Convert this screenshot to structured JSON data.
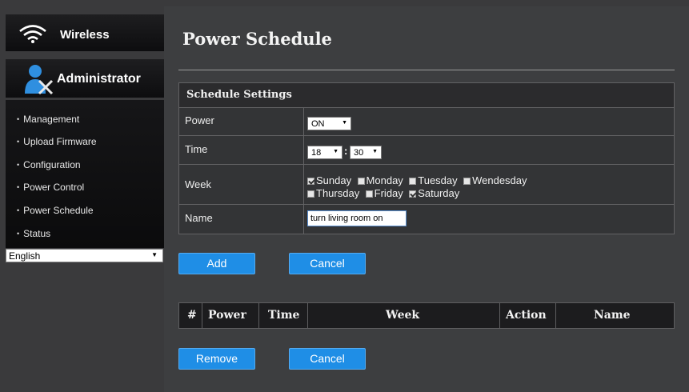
{
  "sidebar": {
    "wireless_label": "Wireless",
    "admin_label": "Administrator",
    "items": [
      {
        "label": "Management"
      },
      {
        "label": "Upload Firmware"
      },
      {
        "label": "Configuration"
      },
      {
        "label": "Power Control"
      },
      {
        "label": "Power Schedule"
      },
      {
        "label": "Status"
      }
    ],
    "language": "English"
  },
  "page": {
    "title": "Power Schedule"
  },
  "schedule_settings": {
    "header": "Schedule Settings",
    "power_label": "Power",
    "power_value": "ON",
    "time_label": "Time",
    "hour_value": "18",
    "time_separator": ":",
    "minute_value": "30",
    "week_label": "Week",
    "days": [
      {
        "label": "Sunday",
        "checked": true
      },
      {
        "label": "Monday",
        "checked": false
      },
      {
        "label": "Tuesday",
        "checked": false
      },
      {
        "label": "Wendesday",
        "checked": false
      },
      {
        "label": "Thursday",
        "checked": false
      },
      {
        "label": "Friday",
        "checked": false
      },
      {
        "label": "Saturday",
        "checked": true
      }
    ],
    "name_label": "Name",
    "name_value": "turn living room on"
  },
  "buttons": {
    "add": "Add",
    "cancel": "Cancel",
    "remove": "Remove",
    "cancel2": "Cancel"
  },
  "schedule_list": {
    "columns": [
      "#",
      "Power",
      "Time",
      "Week",
      "Action",
      "Name"
    ]
  },
  "colors": {
    "button_blue": "#1f8ee6",
    "background": "#3d3e40"
  }
}
